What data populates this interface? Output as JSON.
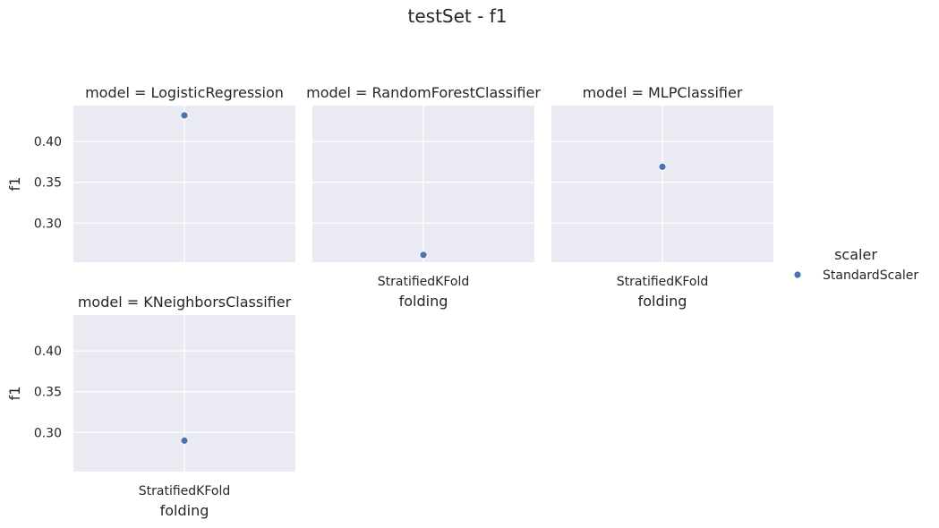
{
  "chart_data": {
    "type": "scatter",
    "title": "testSet - f1",
    "facet_variable": "model",
    "facet_prefix": "model = ",
    "xlabel": "folding",
    "ylabel": "f1",
    "categories": [
      "StratifiedKFold"
    ],
    "ylim": [
      0.252,
      0.444
    ],
    "yticks": [
      0.3,
      0.35,
      0.4
    ],
    "ytick_labels": [
      "0.30",
      "0.35",
      "0.40"
    ],
    "grid": true,
    "legend": {
      "title": "scaler",
      "placement": "right",
      "entries": [
        {
          "name": "StandardScaler",
          "color": "#4c72b0"
        }
      ]
    },
    "colors": {
      "background": "#eaeaf2",
      "grid": "#ffffff",
      "marker": "#4c72b0"
    },
    "facets": [
      {
        "model": "LogisticRegression",
        "points": [
          {
            "x": "StratifiedKFold",
            "y": 0.432,
            "scaler": "StandardScaler"
          }
        ]
      },
      {
        "model": "RandomForestClassifier",
        "points": [
          {
            "x": "StratifiedKFold",
            "y": 0.261,
            "scaler": "StandardScaler"
          }
        ]
      },
      {
        "model": "MLPClassifier",
        "points": [
          {
            "x": "StratifiedKFold",
            "y": 0.369,
            "scaler": "StandardScaler"
          }
        ]
      },
      {
        "model": "KNeighborsClassifier",
        "points": [
          {
            "x": "StratifiedKFold",
            "y": 0.29,
            "scaler": "StandardScaler"
          }
        ]
      }
    ]
  }
}
